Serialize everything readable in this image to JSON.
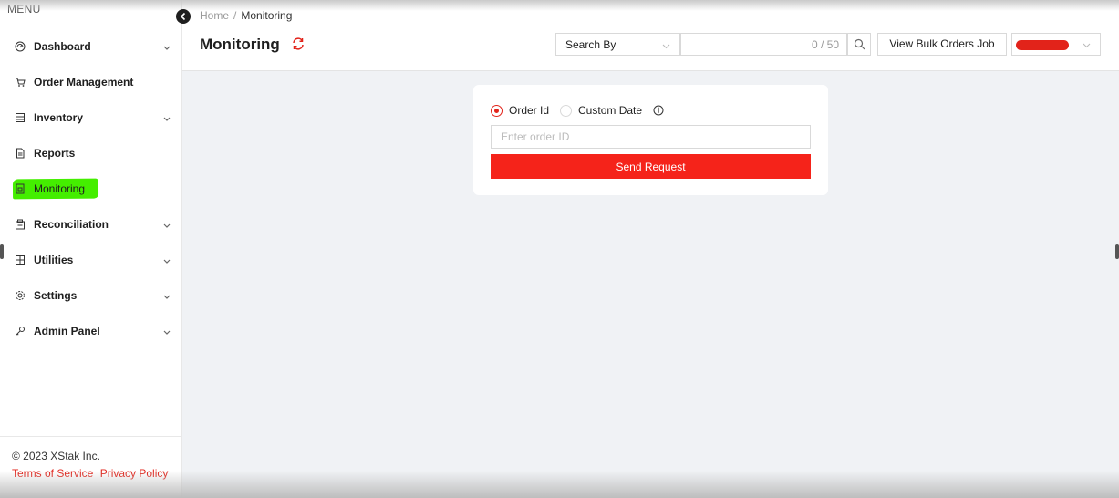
{
  "sidebar": {
    "menu_label": "MENU",
    "items": [
      {
        "label": "Dashboard",
        "icon": "dashboard-icon",
        "has_caret": true
      },
      {
        "label": "Order Management",
        "icon": "cart-icon",
        "has_caret": false
      },
      {
        "label": "Inventory",
        "icon": "inventory-icon",
        "has_caret": true
      },
      {
        "label": "Reports",
        "icon": "file-icon",
        "has_caret": false
      },
      {
        "label": "Monitoring",
        "icon": "monitor-icon",
        "has_caret": false,
        "active": true
      },
      {
        "label": "Reconciliation",
        "icon": "reconciliation-icon",
        "has_caret": true
      },
      {
        "label": "Utilities",
        "icon": "utilities-icon",
        "has_caret": true
      },
      {
        "label": "Settings",
        "icon": "gear-icon",
        "has_caret": true
      },
      {
        "label": "Admin Panel",
        "icon": "key-icon",
        "has_caret": true
      }
    ],
    "footer": {
      "copyright": "© 2023 XStak Inc.",
      "terms": "Terms of Service",
      "privacy": "Privacy Policy"
    }
  },
  "header": {
    "breadcrumb": {
      "home": "Home",
      "separator": "/",
      "current": "Monitoring"
    },
    "title": "Monitoring",
    "search_by": "Search By",
    "search_counter": "0 / 50",
    "bulk_button": "View Bulk Orders Job"
  },
  "form": {
    "option_order_id": "Order Id",
    "option_custom_date": "Custom Date",
    "selected": "Order Id",
    "order_placeholder": "Enter order ID",
    "order_value": "",
    "submit_label": "Send Request"
  },
  "colors": {
    "accent": "#e2231a",
    "highlight": "#44ee00"
  }
}
